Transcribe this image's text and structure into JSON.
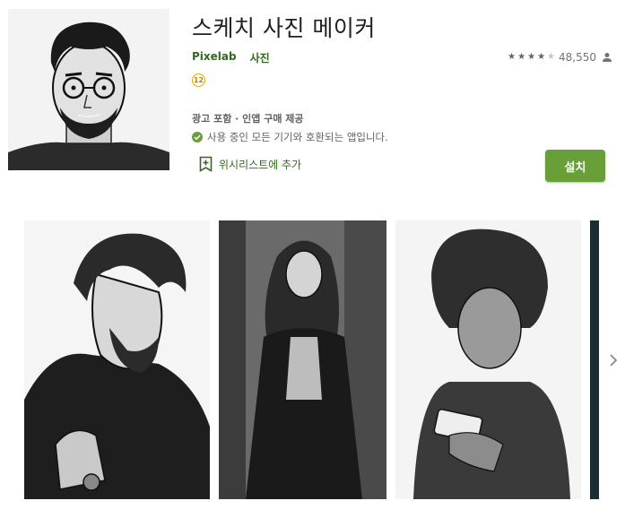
{
  "app": {
    "title": "스케치 사진 메이커",
    "developer": "Pixelab",
    "category": "사진",
    "age_rating": "12",
    "offer": "광고 포함 · 인앱 구매 제공",
    "compatibility": "사용 중인 모든 기기와 호환되는 앱입니다.",
    "wishlist_label": "위시리스트에 추가",
    "install_label": "설치"
  },
  "rating": {
    "stars": 4,
    "max_stars": 5,
    "count": "48,550"
  },
  "icons": {
    "rating_count": "person-icon",
    "compat": "check-circle-icon",
    "wishlist": "bookmark-plus-icon",
    "next": "chevron-right-icon"
  },
  "colors": {
    "accent_green": "#689f38",
    "link_green": "#33691e",
    "age_badge": "#e6a800"
  }
}
